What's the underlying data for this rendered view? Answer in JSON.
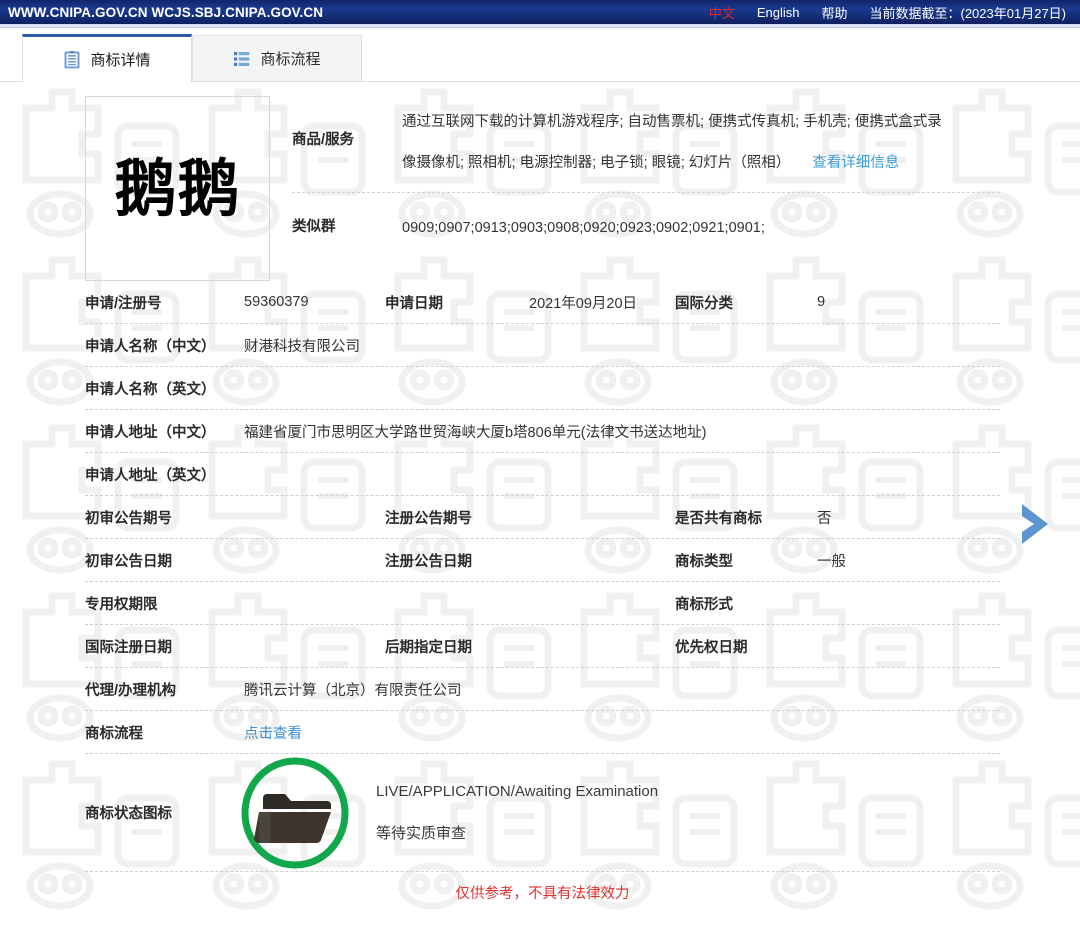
{
  "topbar": {
    "url": "WWW.CNIPA.GOV.CN WCJS.SBJ.CNIPA.GOV.CN",
    "lang_cn": "中文",
    "lang_en": "English",
    "help": "帮助",
    "data_date": "当前数据截至：(2023年01月27日)"
  },
  "tabs": [
    {
      "label": "商标详情",
      "icon": "document-icon",
      "active": true
    },
    {
      "label": "商标流程",
      "icon": "list-icon",
      "active": false
    }
  ],
  "mark": {
    "image_text": "鹅鹅",
    "watermark_text": "中国商标"
  },
  "goods": {
    "label": "商品/服务",
    "line1": "通过互联网下载的计算机游戏程序; 自动售票机; 便携式传真机; 手机壳; 便携式盒式录",
    "line2": "像摄像机; 照相机; 电源控制器; 电子锁; 眼镜; 幻灯片（照相）",
    "detail_link": "查看详细信息"
  },
  "similar_group": {
    "label": "类似群",
    "value": "0909;0907;0913;0903;0908;0920;0923;0902;0921;0901;"
  },
  "fields": {
    "app_no_label": "申请/注册号",
    "app_no_value": "59360379",
    "app_date_label": "申请日期",
    "app_date_value": "2021年09月20日",
    "intl_class_label": "国际分类",
    "intl_class_value": "9",
    "applicant_cn_label": "申请人名称（中文）",
    "applicant_cn_value": "财港科技有限公司",
    "applicant_en_label": "申请人名称（英文）",
    "applicant_en_value": "",
    "address_cn_label": "申请人地址（中文）",
    "address_cn_value": "福建省厦门市思明区大学路世贸海峡大厦b塔806单元(法律文书送达地址)",
    "address_en_label": "申请人地址（英文）",
    "address_en_value": "",
    "prelim_no_label": "初审公告期号",
    "prelim_no_value": "",
    "reg_no_label": "注册公告期号",
    "reg_no_value": "",
    "shared_label": "是否共有商标",
    "shared_value": "否",
    "prelim_date_label": "初审公告日期",
    "prelim_date_value": "",
    "reg_date_label": "注册公告日期",
    "reg_date_value": "",
    "mark_type_label": "商标类型",
    "mark_type_value": "一般",
    "exclusive_label": "专用权期限",
    "exclusive_value": "",
    "mark_form_label": "商标形式",
    "mark_form_value": "",
    "intl_reg_date_label": "国际注册日期",
    "intl_reg_date_value": "",
    "later_date_label": "后期指定日期",
    "later_date_value": "",
    "priority_date_label": "优先权日期",
    "priority_date_value": "",
    "agent_label": "代理/办理机构",
    "agent_value": "腾讯云计算（北京）有限责任公司",
    "process_label": "商标流程",
    "process_link": "点击查看"
  },
  "status": {
    "label": "商标状态图标",
    "icon": "folder-icon",
    "ring_color": "#10a84a",
    "english": "LIVE/APPLICATION/Awaiting Examination",
    "chinese": "等待实质审查"
  },
  "disclaimer": "仅供参考，不具有法律效力",
  "next_arrow": {
    "icon": "chevron-right-icon",
    "color": "#5d96cf"
  },
  "colors": {
    "header_blue": "#15307c",
    "accent_red": "#d62b2b",
    "link_blue": "#3b8fd0",
    "status_green": "#10a84a"
  }
}
